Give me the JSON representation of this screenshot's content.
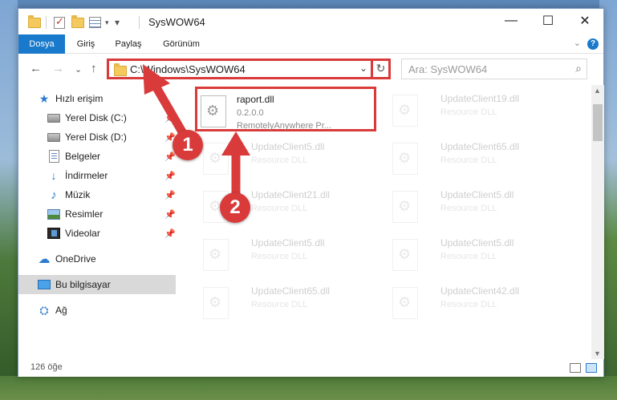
{
  "window": {
    "title": "SysWOW64",
    "minimize": "—",
    "maximize": "☐",
    "close": "✕"
  },
  "ribbon": {
    "tabs": [
      "Dosya",
      "Giriş",
      "Paylaş",
      "Görünüm"
    ],
    "collapse_glyph": "⌄",
    "help": "?"
  },
  "nav": {
    "back": "←",
    "forward": "→",
    "recent": "⌄",
    "up": "↑",
    "address": "C:\\Windows\\SysWOW64",
    "address_dropdown": "⌄",
    "refresh": "↻",
    "search_placeholder": "Ara: SysWOW64",
    "search_icon": "⌕"
  },
  "sidebar": {
    "items": [
      {
        "label": "Hızlı erişim",
        "icon": "star-icon",
        "pinned": false,
        "selected": false
      },
      {
        "label": "Yerel Disk (C:)",
        "icon": "drive-icon",
        "pinned": true,
        "selected": false
      },
      {
        "label": "Yerel Disk (D:)",
        "icon": "drive-icon",
        "pinned": true,
        "selected": false
      },
      {
        "label": "Belgeler",
        "icon": "documents-icon",
        "pinned": true,
        "selected": false
      },
      {
        "label": "İndirmeler",
        "icon": "downloads-icon",
        "pinned": true,
        "selected": false
      },
      {
        "label": "Müzik",
        "icon": "music-icon",
        "pinned": true,
        "selected": false
      },
      {
        "label": "Resimler",
        "icon": "pictures-icon",
        "pinned": true,
        "selected": false
      },
      {
        "label": "Videolar",
        "icon": "videos-icon",
        "pinned": true,
        "selected": false
      },
      {
        "label": "OneDrive",
        "icon": "cloud-icon",
        "pinned": false,
        "selected": false
      },
      {
        "label": "Bu bilgisayar",
        "icon": "computer-icon",
        "pinned": false,
        "selected": true
      },
      {
        "label": "Ağ",
        "icon": "network-icon",
        "pinned": false,
        "selected": false
      }
    ],
    "pin_glyph": "📌"
  },
  "files": [
    {
      "name": "raport.dll",
      "desc": "0.2.0.0",
      "sub": "RemotelyAnywhere Pr...",
      "highlighted": true
    },
    {
      "name": "UpdateClient19.dll",
      "desc": "Resource DLL",
      "sub": "",
      "highlighted": false
    },
    {
      "name": "UpdateClient5.dll",
      "desc": "Resource DLL",
      "sub": "",
      "highlighted": false
    },
    {
      "name": "UpdateClient65.dll",
      "desc": "Resource DLL",
      "sub": "",
      "highlighted": false
    },
    {
      "name": "UpdateClient21.dll",
      "desc": "Resource DLL",
      "sub": "",
      "highlighted": false
    },
    {
      "name": "UpdateClient5.dll",
      "desc": "Resource DLL",
      "sub": "",
      "highlighted": false
    },
    {
      "name": "UpdateClient5.dll",
      "desc": "Resource DLL",
      "sub": "",
      "highlighted": false
    },
    {
      "name": "UpdateClient5.dll",
      "desc": "Resource DLL",
      "sub": "",
      "highlighted": false
    },
    {
      "name": "UpdateClient65.dll",
      "desc": "Resource DLL",
      "sub": "",
      "highlighted": false
    },
    {
      "name": "UpdateClient42.dll",
      "desc": "Resource DLL",
      "sub": "",
      "highlighted": false
    }
  ],
  "status": {
    "item_count": "126 öğe"
  },
  "annotations": {
    "badge1": "1",
    "badge2": "2",
    "color": "#d93a3a"
  }
}
